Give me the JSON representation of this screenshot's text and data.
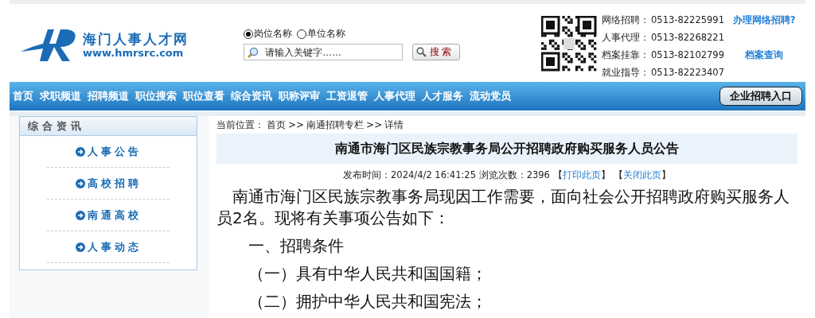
{
  "header": {
    "site_name": "海门人事人才网",
    "site_url": "www.hmrsrc.com",
    "search_modes": [
      {
        "label": "岗位名称",
        "selected": true
      },
      {
        "label": "单位名称",
        "selected": false
      }
    ],
    "search": {
      "placeholder": "请输入关键字……",
      "button": "搜 索"
    },
    "contacts": [
      {
        "label": "网络招聘：",
        "phone": "0513-82225991",
        "link": "办理网络招聘?"
      },
      {
        "label": "人事代理：",
        "phone": "0513-82268221"
      },
      {
        "label": "档案挂靠：",
        "phone": "0513-82102799",
        "link": "档案查询"
      },
      {
        "label": "就业指导：",
        "phone": "0513-82223407"
      }
    ]
  },
  "nav": {
    "items": [
      "首页",
      "求职频道",
      "招聘频道",
      "职位搜索",
      "职位查看",
      "综合资讯",
      "职称评审",
      "工资退管",
      "人事代理",
      "人才服务",
      "流动党员"
    ],
    "enterprise_button": "企业招聘入口"
  },
  "sidebar": {
    "title": "综合资讯",
    "items": [
      "人事公告",
      "高校招聘",
      "南通高校",
      "人事动态"
    ]
  },
  "article": {
    "breadcrumb": {
      "label": "当前位置：",
      "items": [
        "首页",
        "南通招聘专栏",
        "详情"
      ],
      "separator": ">>"
    },
    "title": "南通市海门区民族宗教事务局公开招聘政府购买服务人员公告",
    "meta": "发布时间：2024/4/2 16:41:25 浏览次数：2396",
    "actions": [
      {
        "before": "【",
        "label": "打印此页",
        "after": "】"
      },
      {
        "before": "【",
        "label": "关闭此页",
        "after": "】"
      }
    ],
    "paragraphs": [
      {
        "kind": "intro",
        "text": "南通市海门区民族宗教事务局现因工作需要，面向社会公开招聘政府购买服务人员2名。现将有关事项公告如下："
      },
      {
        "kind": "item",
        "text": "一、招聘条件"
      },
      {
        "kind": "item",
        "text": "（一）具有中华人民共和国国籍；"
      },
      {
        "kind": "item",
        "text": "（二）拥护中华人民共和国宪法；"
      }
    ]
  }
}
